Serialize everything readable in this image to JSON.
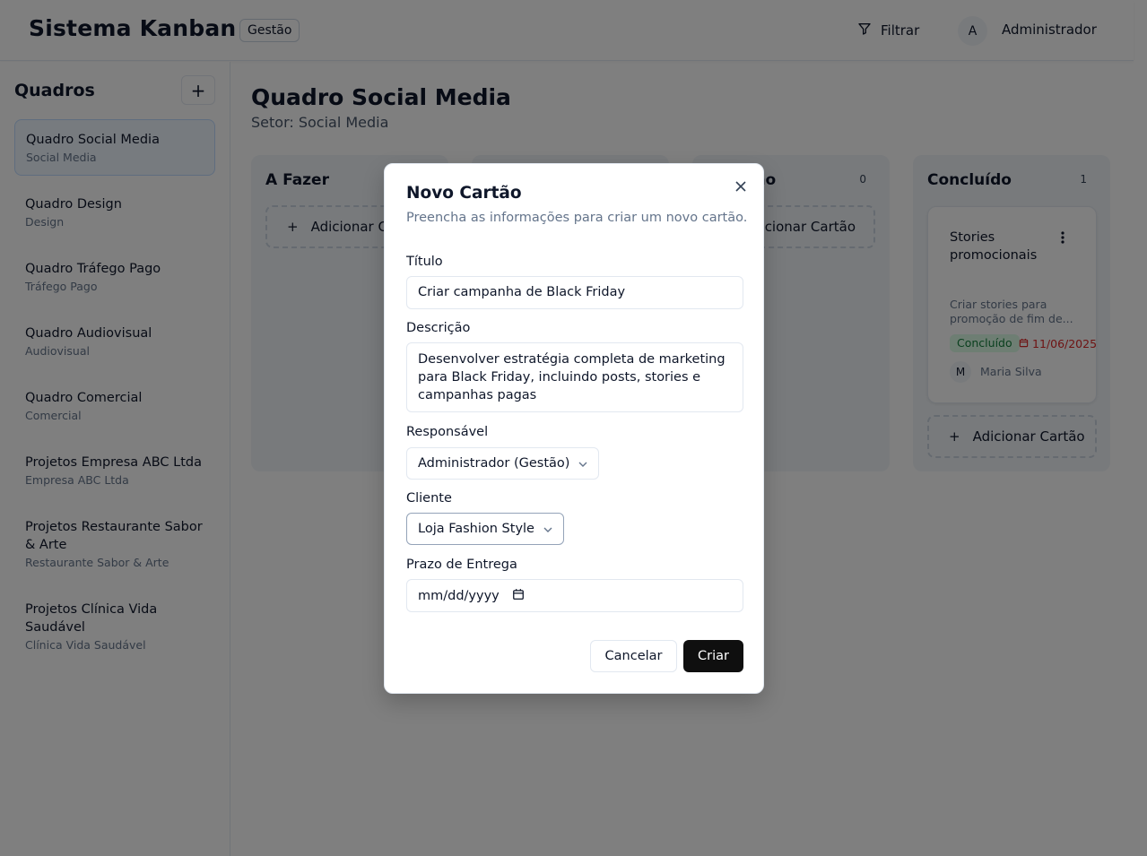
{
  "header": {
    "app_title": "Sistema Kanban",
    "role_badge": "Gestão",
    "filter_label": "Filtrar",
    "user_avatar_initial": "A",
    "user_name": "Administrador"
  },
  "sidebar": {
    "title": "Quadros",
    "add_button": "+",
    "boards": [
      {
        "name": "Quadro Social Media",
        "sector": "Social Media",
        "active": true
      },
      {
        "name": "Quadro Design",
        "sector": "Design"
      },
      {
        "name": "Quadro Tráfego Pago",
        "sector": "Tráfego Pago"
      },
      {
        "name": "Quadro Audiovisual",
        "sector": "Audiovisual"
      },
      {
        "name": "Quadro Comercial",
        "sector": "Comercial"
      },
      {
        "name": "Projetos Empresa ABC Ltda",
        "sector": "Empresa ABC Ltda"
      },
      {
        "name": "Projetos Restaurante Sabor & Arte",
        "sector": "Restaurante Sabor & Arte"
      },
      {
        "name": "Projetos Clínica Vida Saudável",
        "sector": "Clínica Vida Saudável"
      }
    ]
  },
  "main": {
    "title": "Quadro Social Media",
    "subtitle": "Setor: Social Media",
    "add_card_label": "Adicionar Cartão",
    "columns": [
      {
        "title": "A Fazer",
        "count": ""
      },
      {
        "title": "",
        "count": ""
      },
      {
        "title": "ção",
        "count": "0"
      },
      {
        "title": "Concluído",
        "count": "1"
      }
    ],
    "card": {
      "title": "Stories promocionais",
      "description": "Criar stories para promoção de fim de...",
      "status": "Concluído",
      "due_date": "11/06/2025",
      "assignee_initial": "M",
      "assignee": "Maria Silva"
    },
    "partial_add_left": "Adicionar C",
    "partial_add_right": "dicionar Cartão"
  },
  "modal": {
    "title": "Novo Cartão",
    "description": "Preencha as informações para criar um novo cartão.",
    "title_label": "Título",
    "title_value": "Criar campanha de Black Friday",
    "desc_label": "Descrição",
    "desc_value": "Desenvolver estratégia completa de marketing para Black Friday, incluindo posts, stories e campanhas pagas",
    "assignee_label": "Responsável",
    "assignee_value": "Administrador (Gestão)",
    "client_label": "Cliente",
    "client_value": "Loja Fashion Style",
    "deadline_label": "Prazo de Entrega",
    "deadline_placeholder": "mm/dd/yyyy",
    "cancel": "Cancelar",
    "create": "Criar"
  },
  "colors": {
    "primary_button": "#0f0f0f",
    "active_board_bg": "#eff6ff",
    "status_done_bg": "#dcfce7",
    "status_done_text": "#15803d",
    "due_date": "#dc2626"
  }
}
